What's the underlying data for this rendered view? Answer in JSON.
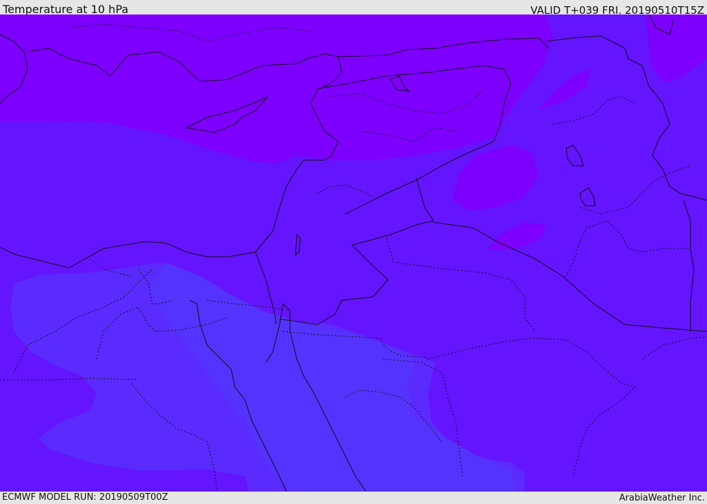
{
  "header": {
    "title": "Temperature at 10 hPa",
    "valid_time": "VALID T+039 FRI. 20190510T15Z"
  },
  "footer": {
    "model_run": "ECMWF MODEL RUN: 20190509T00Z",
    "credit": "ArabiaWeather Inc."
  },
  "colors": {
    "band_cold": "#7d00ff",
    "band_mid": "#6414ff",
    "band_warm": "#5a2aff",
    "band_warmest": "#5533ff",
    "background": "#e6e6e6"
  }
}
